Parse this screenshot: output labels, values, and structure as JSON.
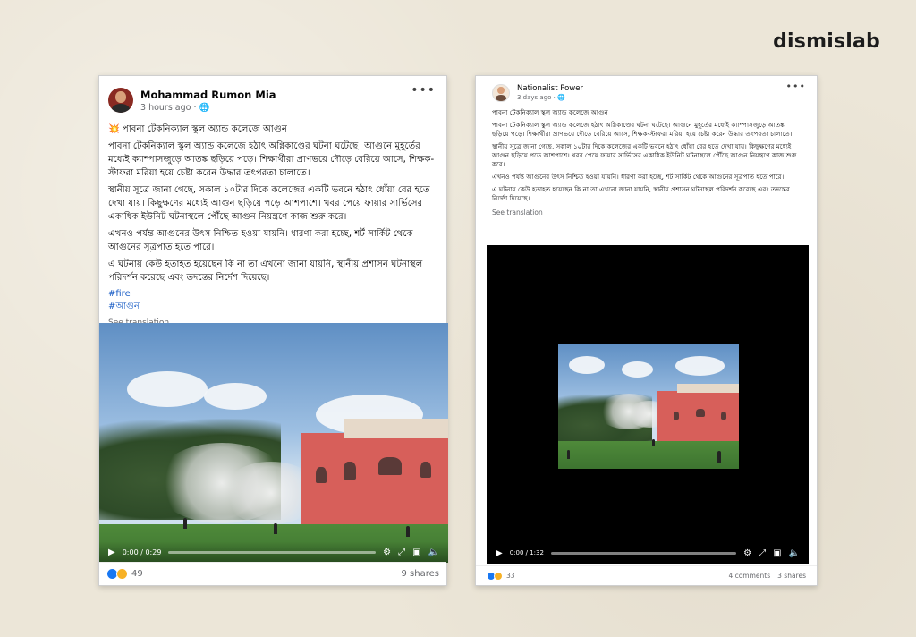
{
  "brand": "dismislab",
  "left_post": {
    "author": "Mohammad Rumon Mia",
    "time": "3 hours ago · ",
    "globe_icon": "🌐",
    "headline_emoji": "💥",
    "headline": " পাবনা টেকনিক্যাল স্কুল অ্যান্ড কলেজে আগুন",
    "paragraphs": [
      "পাবনা টেকনিক্যাল স্কুল অ্যান্ড কলেজে হঠাৎ অগ্নিকাণ্ডের ঘটনা ঘটেছে। আগুনে মুহূর্তের মধ্যেই ক্যাম্পাসজুড়ে আতঙ্ক ছড়িয়ে পড়ে। শিক্ষার্থীরা প্রাণভয়ে দৌড়ে বেরিয়ে আসে, শিক্ষক-স্টাফরা মরিয়া হয়ে চেষ্টা করেন উদ্ধার তৎপরতা চালাতে।",
      "স্থানীয় সূত্রে জানা গেছে, সকাল ১০টার দিকে কলেজের একটি ভবনে হঠাৎ ধোঁয়া বের হতে দেখা যায়। কিছুক্ষণের মধ্যেই আগুন ছড়িয়ে পড়ে আশপাশে। খবর পেয়ে ফায়ার সার্ভিসের একাধিক ইউনিট ঘটনাস্থলে পৌঁছে আগুন নিয়ন্ত্রণে কাজ শুরু করে।",
      "এখনও পর্যন্ত আগুনের উৎস নিশ্চিত হওয়া যায়নি। ধারণা করা হচ্ছে, শর্ট সার্কিট থেকে আগুনের সূত্রপাত হতে পারে।",
      "এ ঘটনায় কেউ হতাহত হয়েছেন কি না তা এখনো জানা যায়নি, স্থানীয় প্রশাসন ঘটনাস্থল পরিদর্শন করেছে এবং তদন্তের নির্দেশ দিয়েছে।"
    ],
    "hashtags": [
      "#fire",
      "#আগুন"
    ],
    "see_translation": "See translation",
    "video_time": "0:00 / 0:29",
    "reactions_count": "49",
    "shares": "9 shares"
  },
  "right_post": {
    "author": "Nationalist Power",
    "time": "3 days ago · ",
    "globe_icon": "🌐",
    "paragraphs": [
      "পাবনা টেকনিক্যাল স্কুল অ্যান্ড কলেজে আগুন",
      "পাবনা টেকনিক্যাল স্কুল অ্যান্ড কলেজে হঠাৎ অগ্নিকাণ্ডের ঘটনা ঘটেছে। আগুনে মুহূর্তের মধ্যেই ক্যাম্পাসজুড়ে আতঙ্ক ছড়িয়ে পড়ে। শিক্ষার্থীরা প্রাণভয়ে দৌড়ে বেরিয়ে আসে, শিক্ষক-স্টাফরা মরিয়া হয়ে চেষ্টা করেন উদ্ধার তৎপরতা চালাতে।",
      "স্থানীয় সূত্রে জানা গেছে, সকাল ১০টার দিকে কলেজের একটি ভবনে হঠাৎ ধোঁয়া বের হতে দেখা যায়। কিছুক্ষণের মধ্যেই আগুন ছড়িয়ে পড়ে আশপাশে। খবর পেয়ে ফায়ার সার্ভিসের একাধিক ইউনিট ঘটনাস্থলে পৌঁছে আগুন নিয়ন্ত্রণে কাজ শুরু করে।",
      "এখনও পর্যন্ত আগুনের উৎস নিশ্চিত হওয়া যায়নি। ধারণা করা হচ্ছে, শর্ট সার্কিট থেকে আগুনের সূত্রপাত হতে পারে।",
      "এ ঘটনায় কেউ হতাহত হয়েছেন কি না তা এখনো জানা যায়নি, স্থানীয় প্রশাসন ঘটনাস্থল পরিদর্শন করেছে এবং তদন্তের নির্দেশ দিয়েছে।"
    ],
    "see_translation": "See translation",
    "video_time": "0:00 / 1:32",
    "reactions_count": "33",
    "comments": "4 comments",
    "shares": "3 shares"
  },
  "icons": {
    "more": "•••",
    "play": "▶",
    "settings": "⚙",
    "fullscreen": "⤢",
    "pip": "▣",
    "volume": "🔈"
  }
}
